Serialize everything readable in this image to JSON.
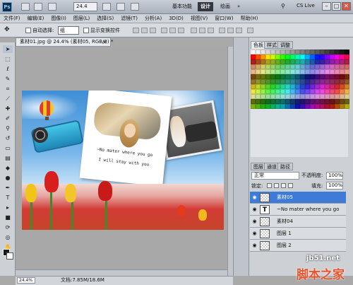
{
  "titlebar": {
    "logo": "Ps",
    "zoom": "24.4",
    "workspaces": [
      "基本功能",
      "设计",
      "绘画"
    ],
    "active_workspace": "设计",
    "more": "»",
    "cs_live": "CS Live",
    "window_buttons": [
      "–",
      "□",
      "✕"
    ]
  },
  "menu": [
    "文件(F)",
    "编辑(E)",
    "图像(I)",
    "图层(L)",
    "选择(S)",
    "滤镜(T)",
    "分析(A)",
    "3D(D)",
    "视图(V)",
    "窗口(W)",
    "帮助(H)"
  ],
  "options": {
    "auto_select_label": "自动选择:",
    "auto_select_value": "组",
    "show_transform_label": "显示变换控件"
  },
  "document": {
    "tab_title": "素材01.jpg @ 24.4% (素材05, RGB/8) *",
    "zoom_status": "24.4%",
    "doc_size": "文档:7.85M/18.6M",
    "card_line1": "~No mater where you go",
    "card_line2": "I will stay with you"
  },
  "panels": {
    "tabs_top": [
      "色板",
      "样式",
      "调整"
    ],
    "tabs_layers": [
      "图层",
      "通道",
      "路径"
    ],
    "blend_mode": "正常",
    "opacity_label": "不透明度:",
    "opacity_value": "100%",
    "lock_label": "锁定:",
    "fill_label": "填充:",
    "fill_value": "100%",
    "layers": [
      {
        "name": "素材05",
        "type": "image",
        "active": true
      },
      {
        "name": "~No mater where you go",
        "type": "text",
        "active": false
      },
      {
        "name": "素材04",
        "type": "image",
        "active": false
      },
      {
        "name": "图层 1",
        "type": "image",
        "active": false
      },
      {
        "name": "图层 2",
        "type": "image",
        "active": false
      }
    ],
    "text_thumb": "T"
  },
  "watermark": {
    "url": "jb51.net",
    "brand": "脚本之家"
  },
  "icons": {
    "eye": "eye-icon",
    "tools": [
      "move-tool-icon",
      "marquee-tool-icon",
      "lasso-tool-icon",
      "quick-select-icon",
      "crop-tool-icon",
      "eyedropper-icon",
      "healing-brush-icon",
      "brush-tool-icon",
      "clone-stamp-icon",
      "history-brush-icon",
      "eraser-icon",
      "gradient-tool-icon",
      "blur-tool-icon",
      "dodge-tool-icon",
      "pen-tool-icon",
      "type-tool-icon",
      "path-select-icon",
      "shape-tool-icon",
      "3d-rotate-icon",
      "3d-orbit-icon",
      "hand-tool-icon",
      "zoom-tool-icon"
    ]
  },
  "colors": {
    "active_layer": "#3d7bd6",
    "foreground": "#1a1a1a",
    "background": "#ffffff"
  }
}
